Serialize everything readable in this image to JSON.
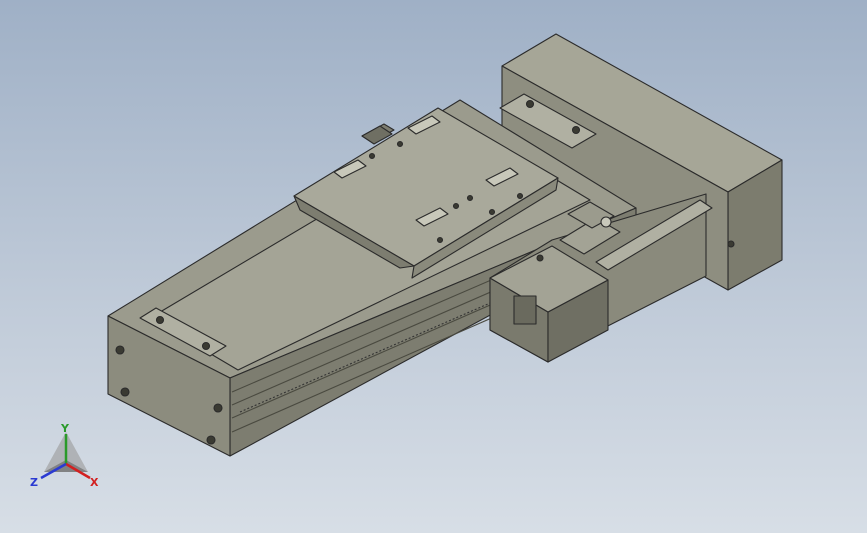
{
  "viewport": {
    "background_top": "#9fb0c6",
    "background_bottom": "#d7dee6"
  },
  "model": {
    "body_color": "#8a8a7c",
    "edge_color": "#2b2b2b"
  },
  "triad": {
    "x_label": "X",
    "y_label": "Y",
    "z_label": "Z",
    "x_color": "#d22020",
    "y_color": "#2a9a2a",
    "z_color": "#2a3ad2"
  }
}
